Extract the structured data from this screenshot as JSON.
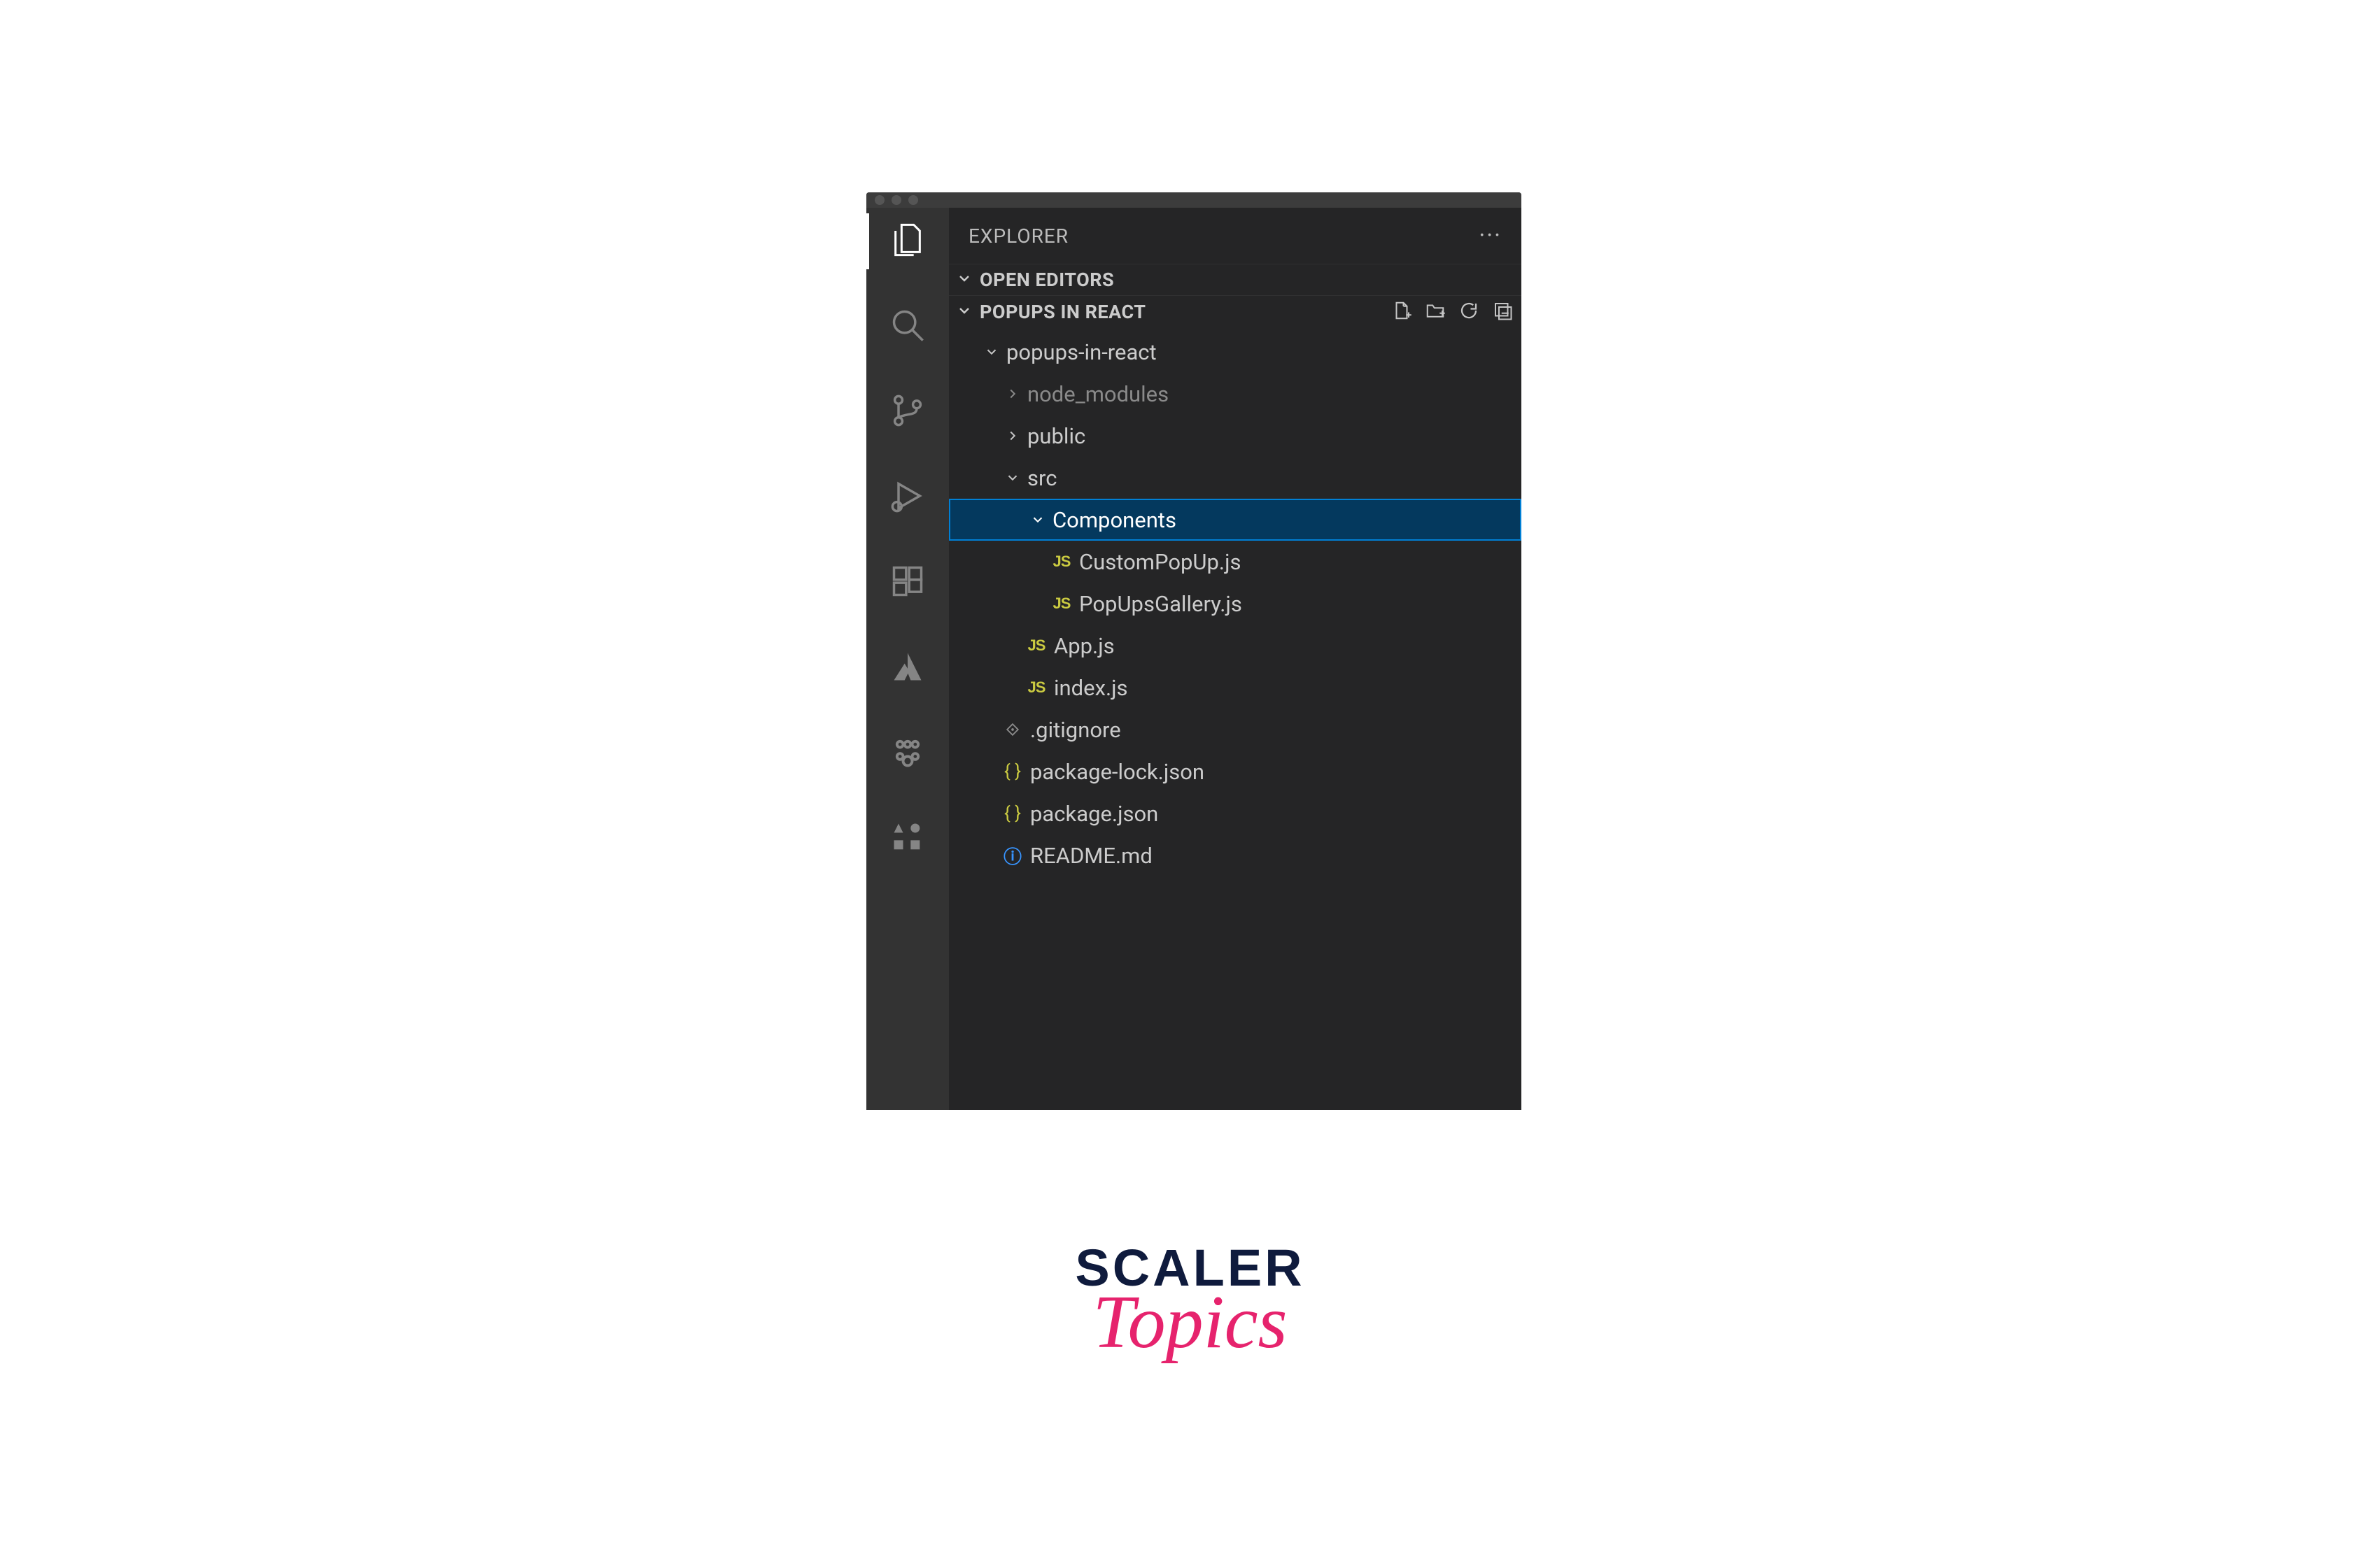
{
  "sidebar": {
    "title": "EXPLORER",
    "sections": {
      "open_editors": "OPEN EDITORS",
      "workspace": "POPUPS IN REACT"
    }
  },
  "tree": {
    "root": "popups-in-react",
    "node_modules": "node_modules",
    "public": "public",
    "src": "src",
    "components": "Components",
    "custom_popup": "CustomPopUp.js",
    "popups_gallery": "PopUpsGallery.js",
    "app_js": "App.js",
    "index_js": "index.js",
    "gitignore": ".gitignore",
    "package_lock": "package-lock.json",
    "package_json": "package.json",
    "readme": "README.md"
  },
  "icons": {
    "js": "JS",
    "json": "{ }",
    "info": "ⓘ"
  },
  "watermark": {
    "line1": "SCALER",
    "line2": "Topics"
  }
}
